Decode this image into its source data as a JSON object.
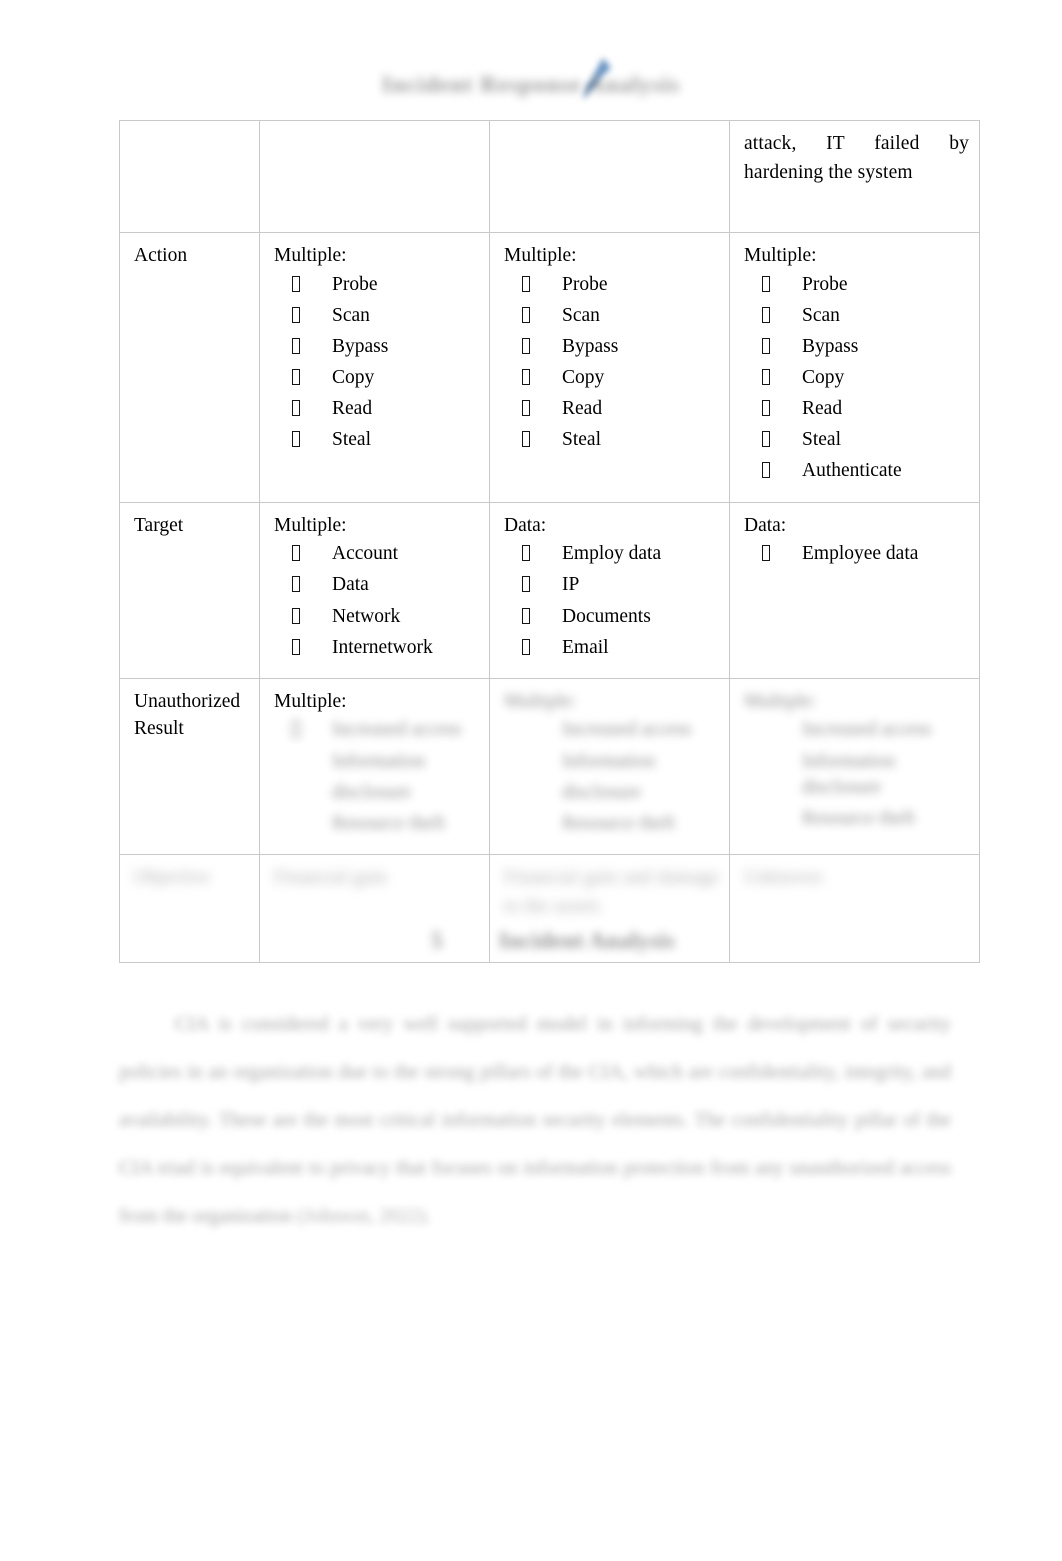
{
  "document": {
    "header": {
      "text": "Incident Response Analysis",
      "logo_icon": "blue-swoosh-logo"
    },
    "table": {
      "columns": 4,
      "rows": [
        {
          "label": "",
          "cells": [
            {
              "heading": "",
              "items": [],
              "text": ""
            },
            {
              "heading": "",
              "items": [],
              "text": ""
            },
            {
              "heading": "",
              "items": [],
              "text": "attack, IT failed by hardening the system"
            }
          ]
        },
        {
          "label": "Action",
          "cells": [
            {
              "heading": "Multiple:",
              "items": [
                "Probe",
                "Scan",
                "Bypass",
                "Copy",
                "Read",
                "Steal"
              ]
            },
            {
              "heading": "Multiple:",
              "items": [
                "Probe",
                "Scan",
                "Bypass",
                "Copy",
                "Read",
                "Steal"
              ]
            },
            {
              "heading": "Multiple:",
              "items": [
                "Probe",
                "Scan",
                "Bypass",
                "Copy",
                "Read",
                "Steal",
                "Authenticate"
              ]
            }
          ]
        },
        {
          "label": "Target",
          "cells": [
            {
              "heading": "Multiple:",
              "items": [
                "Account",
                "Data",
                "Network",
                "Internetwork"
              ]
            },
            {
              "heading": "Data:",
              "items": [
                "Employ data",
                "IP",
                "Documents",
                "Email"
              ]
            },
            {
              "heading": "Data:",
              "items": [
                "Employee data"
              ]
            }
          ]
        },
        {
          "label": "Unauthorized\nResult",
          "cells": [
            {
              "heading": "Multiple:",
              "items": [
                "Increased access",
                "Information",
                "disclosure",
                "Resource theft"
              ]
            },
            {
              "heading": "Multiple:",
              "items": [
                "Increased access",
                "Information",
                "disclosure",
                "Resource theft"
              ]
            },
            {
              "heading": "Multiple:",
              "items": [
                "Increased access",
                "Information disclosure",
                "Resource theft"
              ]
            }
          ]
        },
        {
          "label": "Objective",
          "cells": [
            {
              "heading": "",
              "items": [],
              "text": "Financial gain"
            },
            {
              "heading": "",
              "items": [],
              "text": "Financial gain and damage to the assets"
            },
            {
              "heading": "",
              "items": [],
              "text": "Unknown"
            }
          ]
        }
      ]
    },
    "section": {
      "number": "5",
      "title": "Incident Analysis"
    },
    "paragraph": {
      "text": "CIA is considered a very well supported model in informing the development of security policies in an organization due to the strong pillars of the CIA, which are confidentiality, integrity, and availability. These are the most critical information security elements. The confidentiality pillar of the CIA triad is equivalent to privacy that focuses on information protection from any unauthorized access from the organization",
      "citation": " (Johnson, 2022)."
    }
  }
}
